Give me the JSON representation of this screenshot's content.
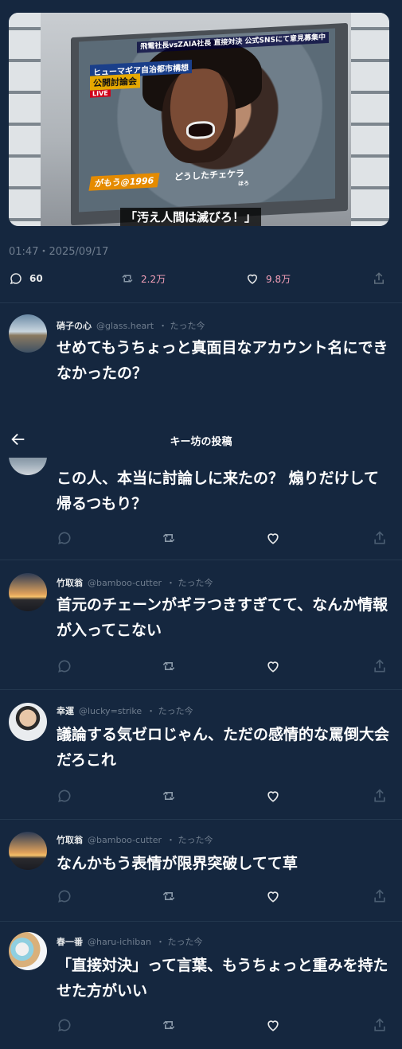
{
  "media": {
    "overlay_top_left": "ヒューマギア自治都市構想",
    "overlay_top_left2": "公開討論会",
    "overlay_live": "LIVE",
    "overlay_top_right": "飛電社長vsZAIA社長 直接対決 公式SNSにて意見募集中",
    "overlay_name": "がもう@1996",
    "overlay_mid": "どうしたチェケラ",
    "overlay_furigana": "ほろ",
    "subtitle": "「汚え人間は滅びろ！」"
  },
  "post": {
    "timestamp": "01:47・2025/09/17",
    "replies": "60",
    "retweets": "2.2万",
    "likes": "9.8万"
  },
  "topbar": {
    "title": "キー坊の投稿"
  },
  "replies": [
    {
      "name": "硝子の心",
      "handle": "@glass.heart",
      "time": "・ たった今",
      "text": "せめてもうちょっと真面目なアカウント名にできなかったの？"
    },
    {
      "name": "",
      "handle": "",
      "time": "",
      "text": "この人、本当に討論しに来たの？ 煽りだけして帰るつもり？"
    },
    {
      "name": "竹取翁",
      "handle": "@bamboo-cutter",
      "time": "・ たった今",
      "text": "首元のチェーンがギラつきすぎてて、なんか情報が入ってこない"
    },
    {
      "name": "幸運",
      "handle": "@lucky=strike",
      "time": "・ たった今",
      "text": "議論する気ゼロじゃん、ただの感情的な罵倒大会だろこれ"
    },
    {
      "name": "竹取翁",
      "handle": "@bamboo-cutter",
      "time": "・ たった今",
      "text": "なんかもう表情が限界突破してて草"
    },
    {
      "name": "春一番",
      "handle": "@haru-ichiban",
      "time": "・ たった今",
      "text": "「直接対決」って言葉、もうちょっと重みを持たせた方がいい"
    }
  ],
  "colors": {
    "bg": "#15273f",
    "retweet": "#f4a0b8",
    "like": "#f4a0b8",
    "muted": "#6f7d8e"
  }
}
